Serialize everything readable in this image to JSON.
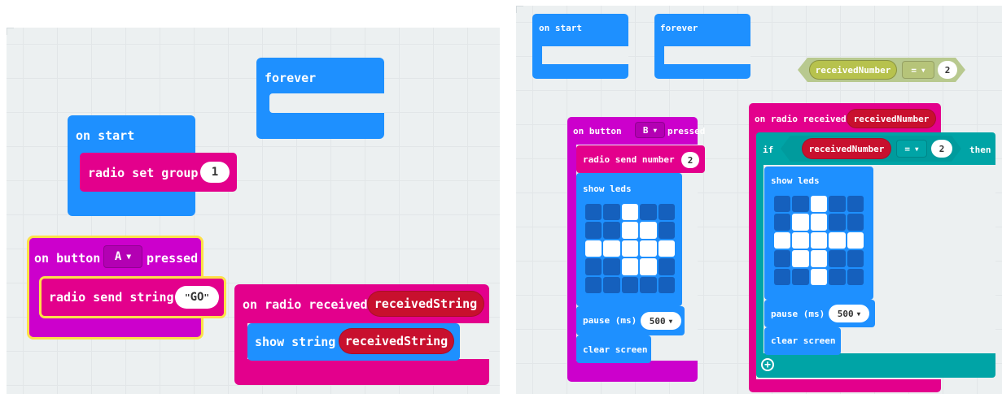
{
  "left_workspace": {
    "forever": {
      "label": "forever"
    },
    "on_start": {
      "label": "on start",
      "radio_set_group": "radio set group",
      "group_value": "1"
    },
    "on_button": {
      "prefix": "on button",
      "button": "A",
      "suffix": "pressed",
      "send_string": "radio send string",
      "string_value": "GO"
    },
    "on_radio_received": {
      "label": "on radio received",
      "param": "receivedString",
      "show_string": "show string",
      "show_value": "receivedString"
    }
  },
  "right_workspace": {
    "on_start": {
      "label": "on start"
    },
    "forever": {
      "label": "forever"
    },
    "compare": {
      "left": "receivedNumber",
      "op": "=",
      "right": "2"
    },
    "on_button": {
      "prefix": "on button",
      "button": "B",
      "suffix": "pressed",
      "send_number": "radio send number",
      "number_value": "2",
      "show_leds": "show leds",
      "leds": [
        [
          0,
          0,
          1,
          0,
          0
        ],
        [
          0,
          0,
          1,
          1,
          0
        ],
        [
          1,
          1,
          1,
          1,
          1
        ],
        [
          0,
          0,
          1,
          1,
          0
        ],
        [
          0,
          0,
          0,
          0,
          0
        ]
      ],
      "pause": "pause (ms)",
      "pause_value": "500",
      "clear": "clear screen"
    },
    "on_radio_received": {
      "label": "on radio received",
      "param": "receivedNumber",
      "if": "if",
      "then": "then",
      "cond_left": "receivedNumber",
      "cond_op": "=",
      "cond_right": "2",
      "show_leds": "show leds",
      "leds": [
        [
          0,
          0,
          1,
          0,
          0
        ],
        [
          0,
          1,
          1,
          0,
          0
        ],
        [
          1,
          1,
          1,
          1,
          1
        ],
        [
          0,
          1,
          1,
          0,
          0
        ],
        [
          0,
          0,
          1,
          0,
          0
        ]
      ],
      "pause": "pause (ms)",
      "pause_value": "500",
      "clear": "clear screen"
    }
  },
  "colors": {
    "basic": "#1e90ff",
    "radio": "#e3008c",
    "input": "#cc00cc",
    "logic": "#00a4a6",
    "variable": "#dc143c"
  }
}
